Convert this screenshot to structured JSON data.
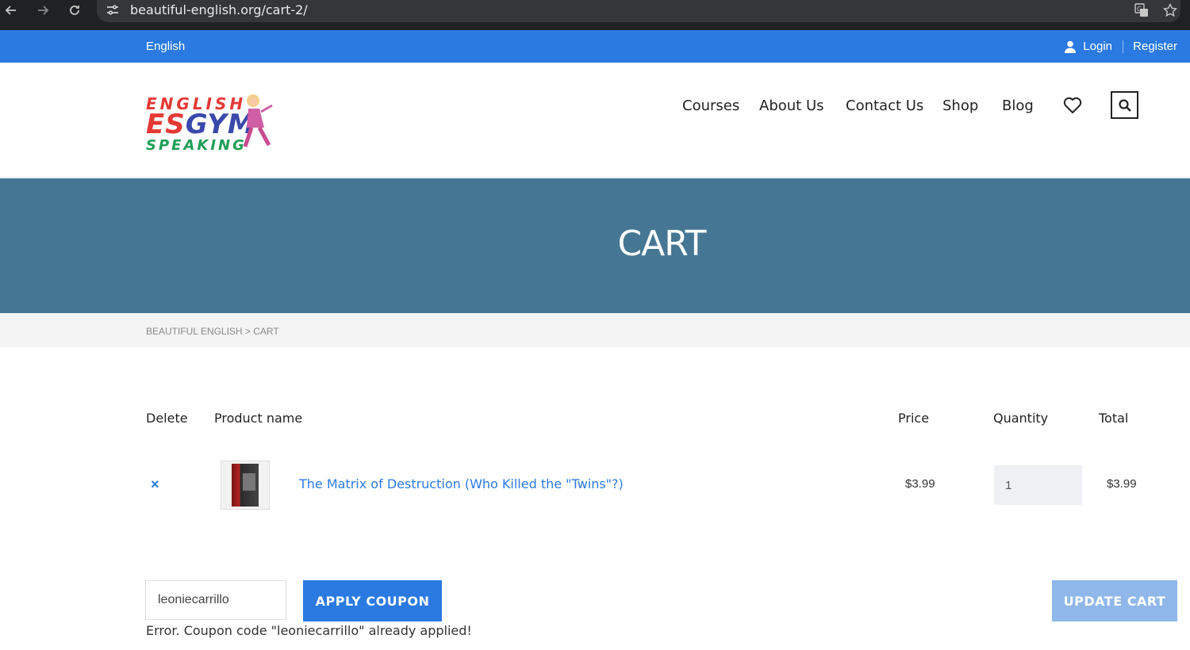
{
  "browser": {
    "url": "beautiful-english.org/cart-2/",
    "icons": [
      "back-icon",
      "forward-icon",
      "reload-icon",
      "site-settings-icon",
      "translate-icon",
      "bookmark-star-icon"
    ]
  },
  "topbar": {
    "language": "English",
    "login": "Login",
    "register": "Register",
    "background": "#2a7ae2"
  },
  "logo": {
    "line1": "ENGLISH",
    "line2a": "ES",
    "line2b": "GYM",
    "line3": "SPEAKING"
  },
  "nav": {
    "items": [
      "Courses",
      "About Us",
      "Contact Us",
      "Shop",
      "Blog"
    ],
    "icons": [
      "heart-icon",
      "search-icon"
    ]
  },
  "banner": {
    "title": "CART",
    "background": "#457794"
  },
  "breadcrumb": {
    "text": "BEAUTIFUL ENGLISH > CART"
  },
  "cart": {
    "headers": {
      "delete": "Delete",
      "product": "Product name",
      "price": "Price",
      "quantity": "Quantity",
      "total": "Total"
    },
    "items": [
      {
        "remove": "×",
        "name": "The Matrix of Destruction (Who Killed the \"Twins\"?)",
        "price": "$3.99",
        "quantity": "1",
        "total": "$3.99"
      }
    ]
  },
  "coupon": {
    "value": "leoniecarrillo",
    "apply_label": "APPLY COUPON",
    "update_label": "UPDATE CART",
    "error": "Error. Coupon code \"leoniecarrillo\" already applied!"
  }
}
